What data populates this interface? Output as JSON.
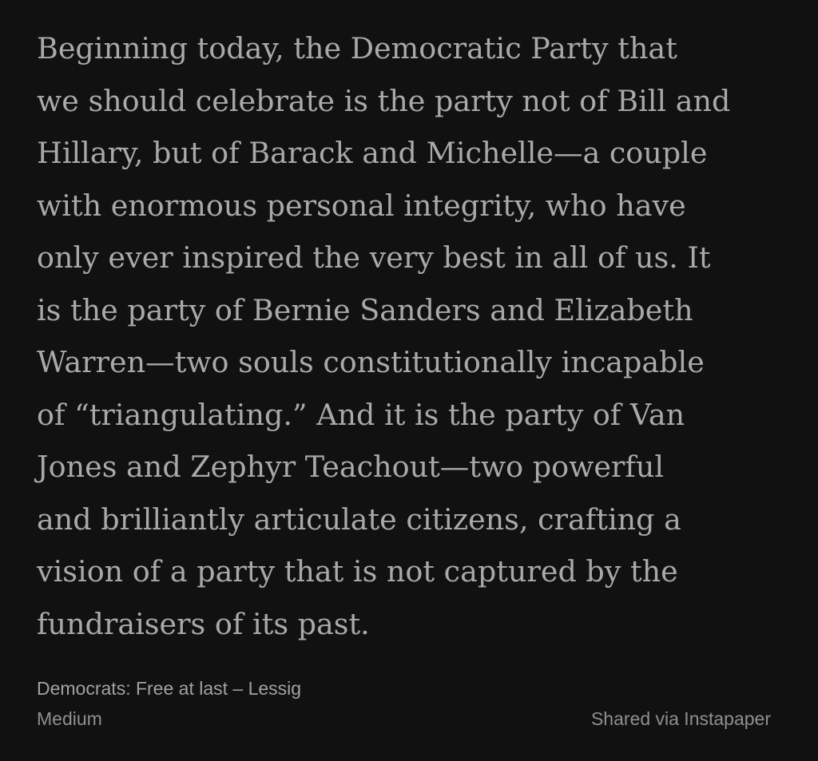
{
  "quote": {
    "lines": [
      "Beginning today, the Democratic Party that",
      "we should celebrate is the party not of Bill and",
      "Hillary, but of Barack and Michelle—a couple",
      "with enormous personal integrity, who have",
      "only ever inspired the very best in all of us. It",
      "is the party of Bernie Sanders and Elizabeth",
      "Warren—two souls constitutionally incapable",
      "of “triangulating.” And it is the party of Van",
      "Jones and Zephyr Teachout—two powerful",
      "and brilliantly articulate citizens, crafting a",
      "vision of a party that is not captured by the",
      "fundraisers of its past."
    ]
  },
  "footer": {
    "article_title": "Democrats: Free at last – Lessig",
    "source": "Medium",
    "shared_via": "Shared via Instapaper"
  },
  "colors": {
    "background": "#111111",
    "quote_text": "#a9a9a9",
    "footer_text": "#8f8f8f"
  }
}
